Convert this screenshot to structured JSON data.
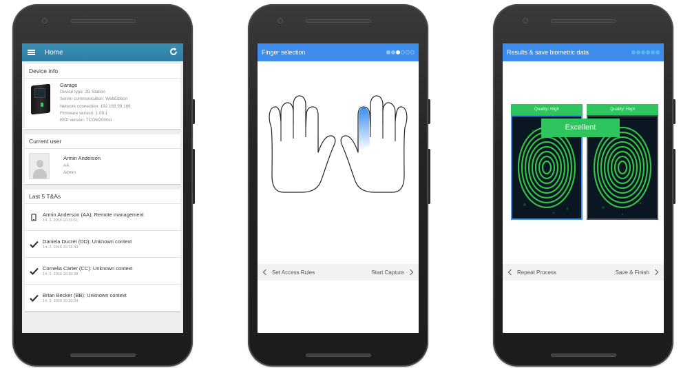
{
  "colors": {
    "home_bar": "#2e7ea5",
    "wizard_bar": "#3e8ded",
    "quality_green": "#2ec45e",
    "selected_finger": "#3a8ef0"
  },
  "phone1": {
    "appbar": {
      "menu_icon": "hamburger-menu-icon",
      "title": "Home",
      "refresh_icon": "refresh-icon"
    },
    "device_info": {
      "header": "Device info",
      "name": "Garage",
      "type": "Device type: 2D Station",
      "server": "Server communication: WebEdition",
      "network": "Network connection: 192.168.99.186",
      "firmware": "Firmware version: 1.09.1",
      "bsp": "BSP version: TCOM2000st"
    },
    "current_user": {
      "header": "Current user",
      "name": "Armin Anderson",
      "initials": "AA",
      "role": "Admin"
    },
    "last_tas": {
      "header": "Last 5 T&As",
      "items": [
        {
          "icon": "phone-icon",
          "text": "Armin Anderson (AA): Remote management",
          "time": "14. 3. 2016 10:33:51"
        },
        {
          "icon": "checkmark-icon",
          "text": "Daniela Ducret (DD): Unknown context",
          "time": "14. 3. 2016 10:33:43"
        },
        {
          "icon": "checkmark-icon",
          "text": "Cornelia Carter (CC): Unknown context",
          "time": "14. 3. 2016 10:33:38"
        },
        {
          "icon": "checkmark-icon",
          "text": "Brian Becker (BB): Unknown context",
          "time": "14. 3. 2016 10:33:34"
        }
      ]
    }
  },
  "phone2": {
    "title": "Finger selection",
    "step": 3,
    "total_steps": 6,
    "nav": {
      "back": "Set Access Rules",
      "next": "Start Capture"
    }
  },
  "phone3": {
    "title": "Results & save biometric data",
    "step": 6,
    "total_steps": 6,
    "quality_left": "Quality: High",
    "quality_right": "Quality: High",
    "result": "Excellent",
    "nav": {
      "back": "Repeat Process",
      "next": "Save & Finish"
    }
  }
}
